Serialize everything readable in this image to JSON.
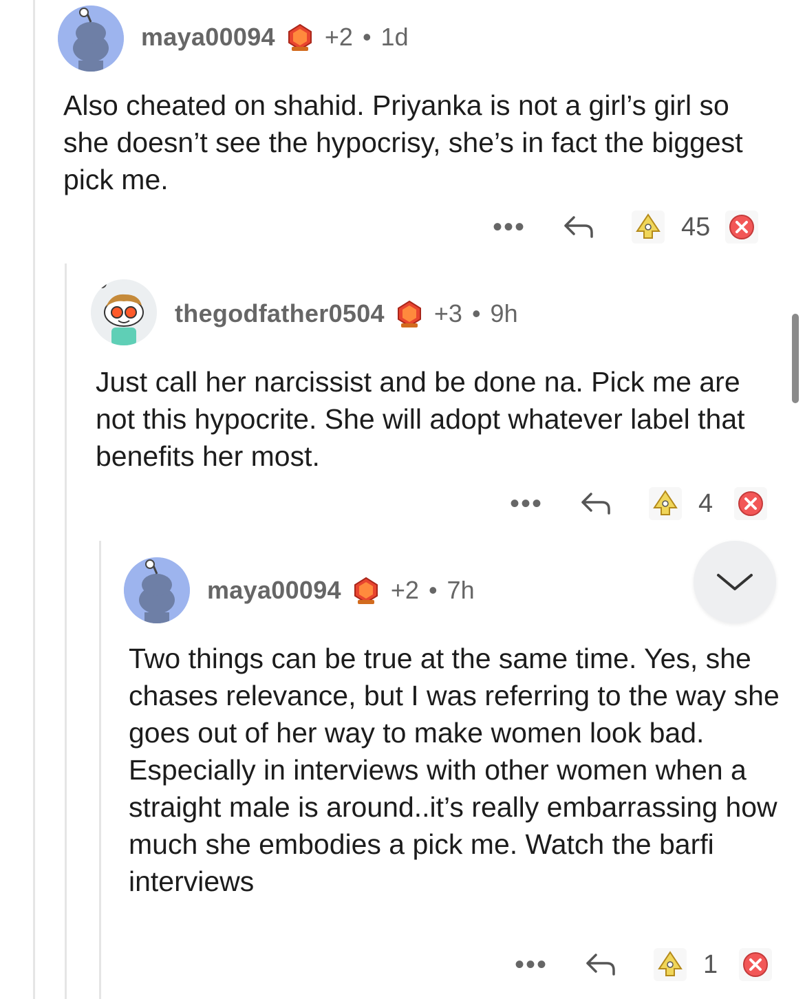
{
  "comments": [
    {
      "username": "maya00094",
      "karma": "+2",
      "age": "1d",
      "body": "Also cheated on shahid. Priyanka is not a girl’s girl so she doesn’t see the hypocrisy, she’s in fact the biggest pick me.",
      "score": "45",
      "more": "•••"
    },
    {
      "username": "thegodfather0504",
      "karma": "+3",
      "age": "9h",
      "body": "Just call her narcissist and be done na. Pick me are not this hypocrite. She will adopt whatever label that benefits her most.",
      "score": "4",
      "more": "•••"
    },
    {
      "username": "maya00094",
      "karma": "+2",
      "age": "7h",
      "body": "Two things can be true at the same time. Yes, she chases relevance, but I was referring to the way she goes out of her way to make women look bad. Especially in interviews with other women when a straight male is around..it’s really embarrassing how much she embodies a pick me. Watch the barfi interviews",
      "score": "1",
      "more": "•••"
    }
  ],
  "dot": "•",
  "icons": {
    "award": "award-gem-icon",
    "reply": "reply-arrow-icon",
    "upvote": "upvote-icon",
    "downvote": "downvote-icon",
    "collapse": "chevron-down-icon"
  },
  "colors": {
    "avatar_blue": "#9db4ee",
    "downvote_red": "#f25757",
    "upvote_yellow": "#f0d65a",
    "award_red": "#e8452f"
  }
}
